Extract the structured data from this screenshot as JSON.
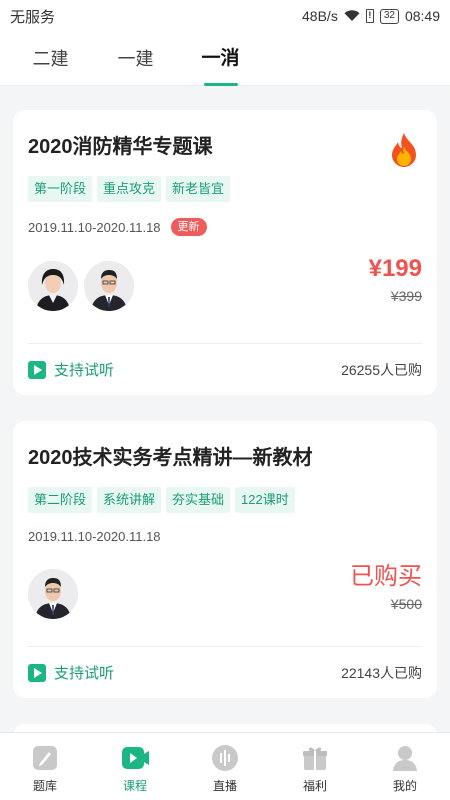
{
  "status": {
    "carrier": "无服务",
    "speed": "48B/s",
    "battery": "32",
    "time": "08:49"
  },
  "tabs": [
    {
      "label": "二建"
    },
    {
      "label": "一建"
    },
    {
      "label": "一消"
    }
  ],
  "courses": [
    {
      "title": "2020消防精华专题课",
      "tags": [
        "第一阶段",
        "重点攻克",
        "新老皆宜"
      ],
      "date": "2019.11.10-2020.11.18",
      "badge": "更新",
      "price": "¥199",
      "original_price": "¥399",
      "trial": "支持试听",
      "buyers": "26255人已购"
    },
    {
      "title": "2020技术实务考点精讲—新教材",
      "tags": [
        "第二阶段",
        "系统讲解",
        "夯实基础",
        "122课时"
      ],
      "date": "2019.11.10-2020.11.18",
      "price": "已购买",
      "original_price": "¥500",
      "trial": "支持试听",
      "buyers": "22143人已购"
    }
  ],
  "bottom_nav": [
    {
      "label": "题库",
      "icon": "question-bank-icon"
    },
    {
      "label": "课程",
      "icon": "course-play-icon"
    },
    {
      "label": "直播",
      "icon": "live-icon"
    },
    {
      "label": "福利",
      "icon": "gift-icon"
    },
    {
      "label": "我的",
      "icon": "profile-icon"
    }
  ],
  "colors": {
    "accent": "#1cb584",
    "price": "#ef5350",
    "tag_bg": "#e8f7f1"
  }
}
